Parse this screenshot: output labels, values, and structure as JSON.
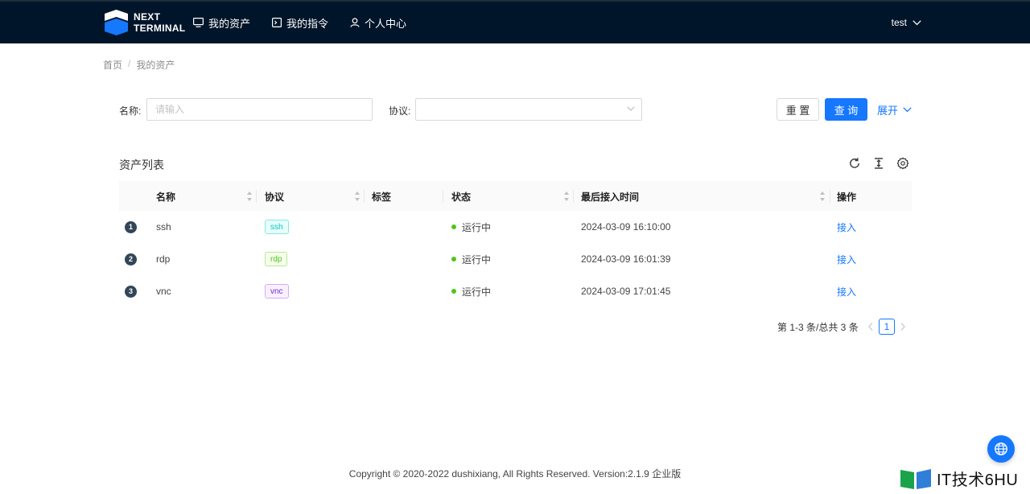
{
  "app": {
    "logo_line1": "NEXT",
    "logo_line2": "TERMINAL",
    "nav": [
      {
        "label": "我的资产",
        "icon": "desktop-icon"
      },
      {
        "label": "我的指令",
        "icon": "terminal-icon"
      },
      {
        "label": "个人中心",
        "icon": "user-icon"
      }
    ],
    "user": "test"
  },
  "breadcrumb": [
    "首页",
    "我的资产"
  ],
  "breadcrumb_sep": "/",
  "search": {
    "name_label": "名称:",
    "name_placeholder": "请输入",
    "name_value": "",
    "protocol_label": "协议:",
    "protocol_value": "",
    "reset_label": "重 置",
    "query_label": "查 询",
    "expand_label": "展开"
  },
  "list": {
    "title": "资产列表",
    "columns": [
      "名称",
      "协议",
      "标签",
      "状态",
      "最后接入时间",
      "操作"
    ],
    "rows": [
      {
        "index": "1",
        "name": "ssh",
        "protocol": "ssh",
        "tags": "",
        "status": "运行中",
        "last_access": "2024-03-09 16:10:00",
        "action": "接入"
      },
      {
        "index": "2",
        "name": "rdp",
        "protocol": "rdp",
        "tags": "",
        "status": "运行中",
        "last_access": "2024-03-09 16:01:39",
        "action": "接入"
      },
      {
        "index": "3",
        "name": "vnc",
        "protocol": "vnc",
        "tags": "",
        "status": "运行中",
        "last_access": "2024-03-09 17:01:45",
        "action": "接入"
      }
    ]
  },
  "pagination": {
    "total_text": "第 1-3 条/总共 3 条",
    "current_page": "1"
  },
  "footer": {
    "copyright": "Copyright © 2020-2022 dushixiang, All Rights Reserved. Version:2.1.9 企业版"
  },
  "watermark": "IT技术6HU",
  "colors": {
    "header_bg": "#001529",
    "primary": "#1677ff",
    "status_running": "#52c41a",
    "tag_ssh": "#13c2c2",
    "tag_rdp": "#52c41a",
    "tag_vnc": "#722ed1"
  }
}
